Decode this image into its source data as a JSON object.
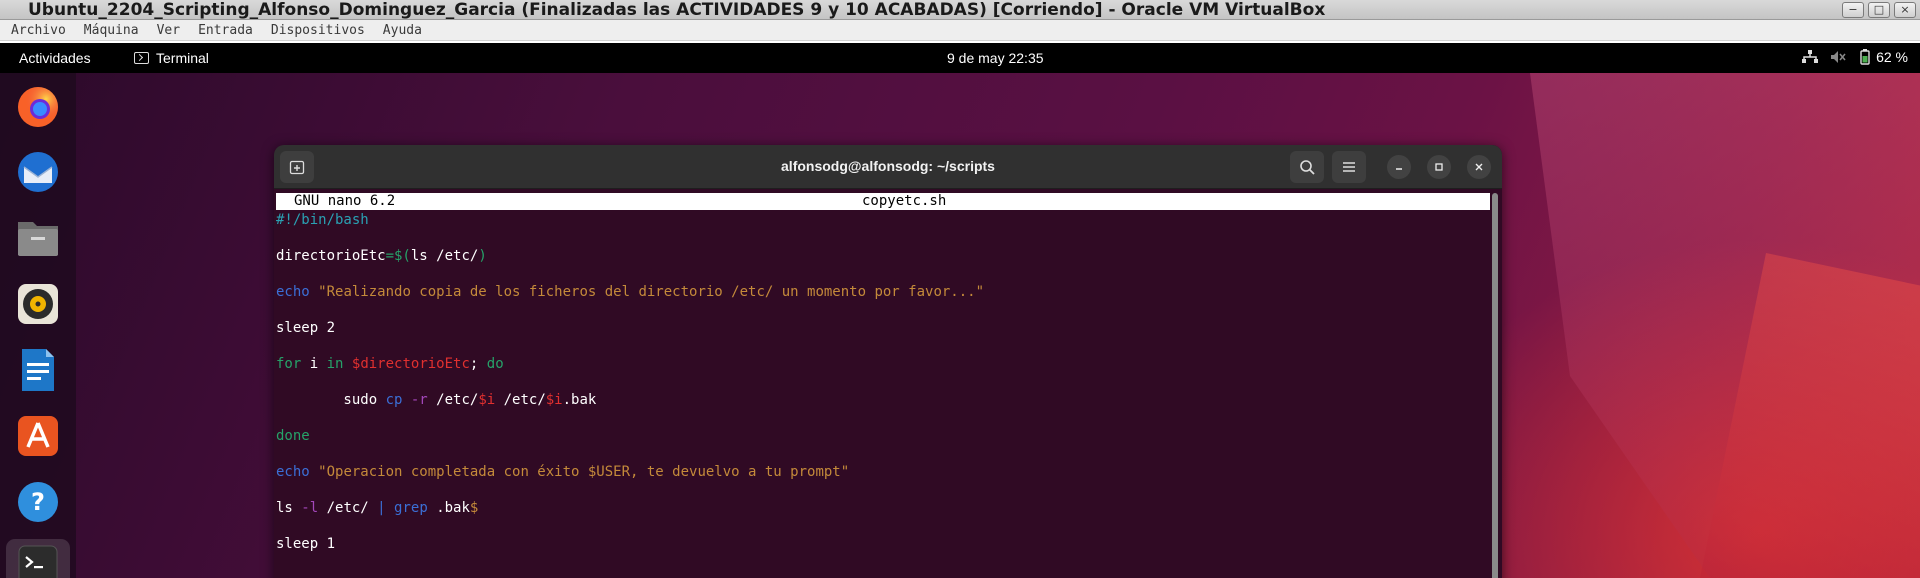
{
  "virtualbox": {
    "title": "Ubuntu_2204_Scripting_Alfonso_Dominguez_Garcia (Finalizadas las ACTIVIDADES 9 y 10 ACABADAS) [Corriendo] - Oracle VM VirtualBox",
    "menu": [
      "Archivo",
      "Máquina",
      "Ver",
      "Entrada",
      "Dispositivos",
      "Ayuda"
    ]
  },
  "topbar": {
    "activities": "Actividades",
    "app_name": "Terminal",
    "clock": "9 de may  22:35",
    "battery": "62 %"
  },
  "dock": {
    "items": [
      "firefox-icon",
      "thunderbird-icon",
      "files-icon",
      "rhythmbox-icon",
      "writer-icon",
      "app-center-icon",
      "help-icon",
      "terminal-icon"
    ]
  },
  "terminal": {
    "title": "alfonsodg@alfonsodg: ~/scripts",
    "nano_version": "GNU nano 6.2",
    "filename": "copyetc.sh",
    "lines": [
      [
        {
          "t": "#!/bin/bash",
          "c": "c-cyan"
        }
      ],
      [
        {
          "t": "directorioEtc",
          "c": ""
        },
        {
          "t": "=$(",
          "c": "c-green"
        },
        {
          "t": "ls /etc/",
          "c": ""
        },
        {
          "t": ")",
          "c": "c-green"
        }
      ],
      [
        {
          "t": "echo",
          "c": "c-blue"
        },
        {
          "t": " ",
          "c": ""
        },
        {
          "t": "\"Realizando copia de los ficheros del directorio /etc/ un momento por favor...\"",
          "c": "c-orange"
        }
      ],
      [
        {
          "t": "sleep 2",
          "c": ""
        }
      ],
      [
        {
          "t": "for",
          "c": "c-green"
        },
        {
          "t": " i ",
          "c": ""
        },
        {
          "t": "in",
          "c": "c-green"
        },
        {
          "t": " ",
          "c": ""
        },
        {
          "t": "$directorioEtc",
          "c": "c-red"
        },
        {
          "t": "; ",
          "c": ""
        },
        {
          "t": "do",
          "c": "c-green"
        }
      ],
      [
        {
          "t": "        sudo ",
          "c": ""
        },
        {
          "t": "cp",
          "c": "c-blue"
        },
        {
          "t": " ",
          "c": ""
        },
        {
          "t": "-r",
          "c": "c-purple"
        },
        {
          "t": " /etc/",
          "c": ""
        },
        {
          "t": "$i",
          "c": "c-red"
        },
        {
          "t": " /etc/",
          "c": ""
        },
        {
          "t": "$i",
          "c": "c-red"
        },
        {
          "t": ".bak",
          "c": ""
        }
      ],
      [
        {
          "t": "done",
          "c": "c-green"
        }
      ],
      [
        {
          "t": "echo",
          "c": "c-blue"
        },
        {
          "t": " ",
          "c": ""
        },
        {
          "t": "\"Operacion completada con éxito $USER, te devuelvo a tu prompt\"",
          "c": "c-orange"
        }
      ],
      [
        {
          "t": "ls ",
          "c": ""
        },
        {
          "t": "-l",
          "c": "c-purple"
        },
        {
          "t": " /etc/ ",
          "c": ""
        },
        {
          "t": "|",
          "c": "c-blue"
        },
        {
          "t": " ",
          "c": ""
        },
        {
          "t": "grep",
          "c": "c-blue"
        },
        {
          "t": " .bak",
          "c": ""
        },
        {
          "t": "$",
          "c": "c-orange"
        }
      ],
      [
        {
          "t": "sleep 1",
          "c": ""
        }
      ]
    ]
  }
}
